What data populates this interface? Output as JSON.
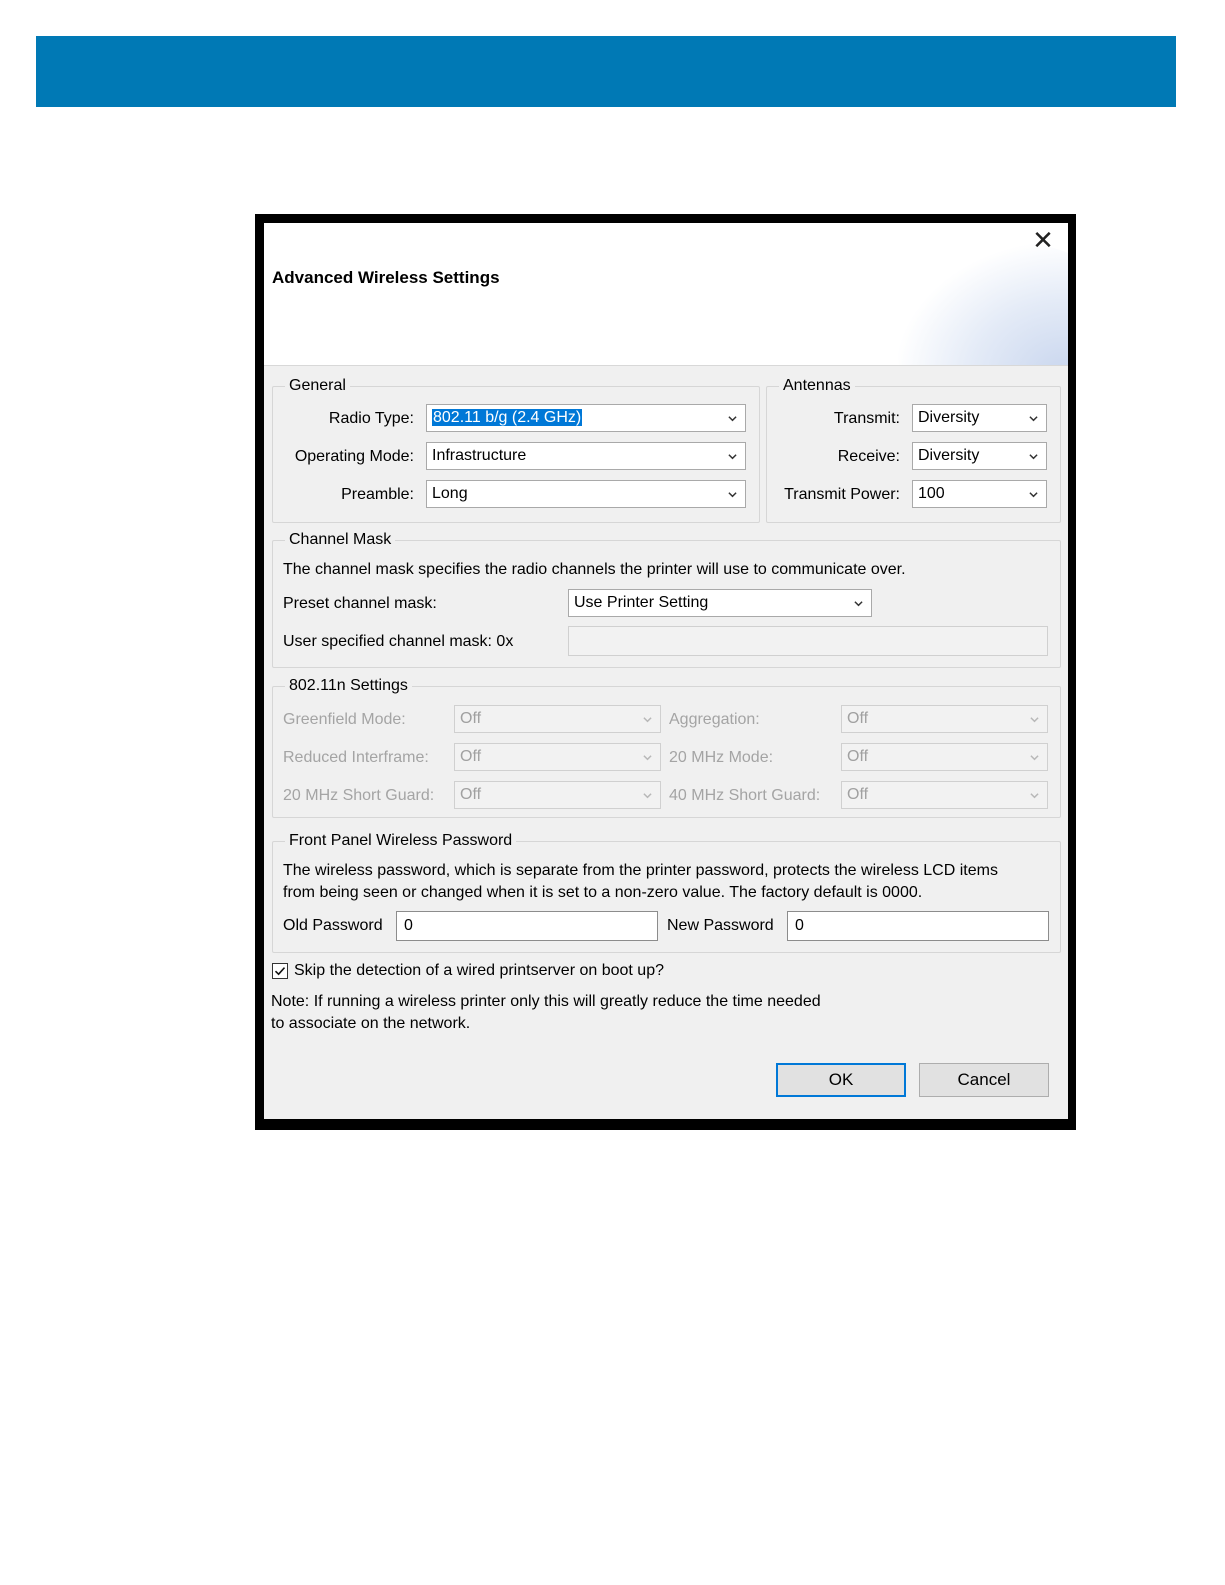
{
  "dialog": {
    "title": "Advanced Wireless Settings"
  },
  "general": {
    "legend": "General",
    "radio_type_label": "Radio Type:",
    "radio_type_value": "802.11 b/g (2.4 GHz)",
    "operating_mode_label": "Operating Mode:",
    "operating_mode_value": "Infrastructure",
    "preamble_label": "Preamble:",
    "preamble_value": "Long"
  },
  "antennas": {
    "legend": "Antennas",
    "transmit_label": "Transmit:",
    "transmit_value": "Diversity",
    "receive_label": "Receive:",
    "receive_value": "Diversity",
    "transmit_power_label": "Transmit Power:",
    "transmit_power_value": "100"
  },
  "channel_mask": {
    "legend": "Channel Mask",
    "description": "The channel mask specifies the radio channels the printer will use to communicate over.",
    "preset_label": "Preset channel mask:",
    "preset_value": "Use Printer Setting",
    "user_label": "User specified channel mask: 0x",
    "user_value": ""
  },
  "n_settings": {
    "legend": "802.11n Settings",
    "greenfield_label": "Greenfield Mode:",
    "greenfield_value": "Off",
    "aggregation_label": "Aggregation:",
    "aggregation_value": "Off",
    "reduced_interframe_label": "Reduced Interframe:",
    "reduced_interframe_value": "Off",
    "mode_20mhz_label": "20 MHz Mode:",
    "mode_20mhz_value": "Off",
    "short_guard_20_label": "20 MHz Short Guard:",
    "short_guard_20_value": "Off",
    "short_guard_40_label": "40 MHz Short Guard:",
    "short_guard_40_value": "Off"
  },
  "password": {
    "legend": "Front Panel Wireless Password",
    "description_line1": "The wireless password, which is separate from the printer password, protects the wireless LCD items",
    "description_line2": "from being seen or changed when it is set to a non-zero value. The factory default is 0000.",
    "old_label": "Old Password",
    "old_value": "0",
    "new_label": "New Password",
    "new_value": "0"
  },
  "skip_detection": {
    "label": "Skip the detection of a wired printserver on boot up?",
    "checked": true,
    "note_line1": "Note: If running a wireless printer only this will greatly reduce the time needed",
    "note_line2": "to associate on the network."
  },
  "buttons": {
    "ok": "OK",
    "cancel": "Cancel"
  },
  "icons": {
    "close": "close-icon",
    "dropdown": "chevron-down-icon",
    "check": "checkmark-icon"
  },
  "colors": {
    "banner": "#0079b5",
    "selection": "#0078d7",
    "dialog_bg": "#f0f0f0"
  }
}
